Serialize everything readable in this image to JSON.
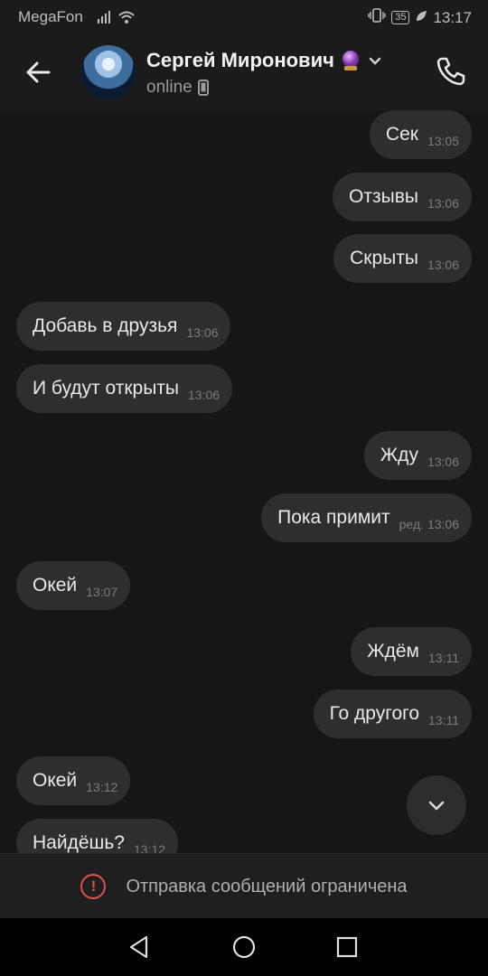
{
  "status_bar": {
    "carrier": "MegaFon",
    "battery": "35",
    "time": "13:17"
  },
  "header": {
    "name": "Сергей Миронович",
    "status": "online",
    "icons": {
      "back": "arrow-left-icon",
      "badge": "crystal-ball-icon",
      "dropdown": "chevron-down-icon",
      "device": "mobile-phone-icon",
      "call": "phone-icon"
    }
  },
  "messages": [
    {
      "side": "out",
      "text": "Сек",
      "time": "13:05"
    },
    {
      "side": "out",
      "text": "Отзывы",
      "time": "13:06"
    },
    {
      "side": "out",
      "text": "Скрыты",
      "time": "13:06"
    },
    {
      "side": "in",
      "text": "Добавь в друзья",
      "time": "13:06"
    },
    {
      "side": "in",
      "text": "И будут открыты",
      "time": "13:06"
    },
    {
      "side": "out",
      "text": "Жду",
      "time": "13:06"
    },
    {
      "side": "out",
      "text": "Пока примит",
      "edited": "ред.",
      "time": "13:06"
    },
    {
      "side": "in",
      "text": "Окей",
      "time": "13:07"
    },
    {
      "side": "out",
      "text": "Ждём",
      "time": "13:11"
    },
    {
      "side": "out",
      "text": "Го другого",
      "time": "13:11"
    },
    {
      "side": "in",
      "text": "Окей",
      "time": "13:12"
    },
    {
      "side": "in",
      "text": "Найдёшь?",
      "time": "13:12"
    }
  ],
  "notice": {
    "text": "Отправка сообщений ограничена",
    "color": "#e2504c"
  },
  "colors": {
    "background": "#161616",
    "bubble": "#2e2e2e",
    "header": "#1b1b1b"
  }
}
